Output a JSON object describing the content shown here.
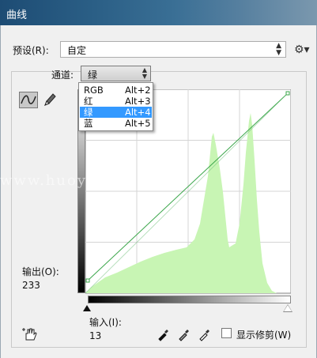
{
  "window": {
    "title": "曲线"
  },
  "preset": {
    "label": "预设(R):",
    "value": "自定"
  },
  "channel": {
    "label": "通道:",
    "value": "绿",
    "options": [
      {
        "name": "RGB",
        "shortcut": "Alt+2"
      },
      {
        "name": "红",
        "shortcut": "Alt+3"
      },
      {
        "name": "绿",
        "shortcut": "Alt+4",
        "selected": true
      },
      {
        "name": "蓝",
        "shortcut": "Alt+5"
      }
    ]
  },
  "output": {
    "label": "输出(O):",
    "value": "233"
  },
  "input": {
    "label": "输入(I):",
    "value": "13"
  },
  "show_clipping": {
    "label": "显示修剪(W)",
    "checked": false
  },
  "watermark": {
    "text": "www.huoy..."
  },
  "colors": {
    "histogram": "#c8f5b4",
    "curve": "#3aa64a",
    "menu_highlight": "#3399ff"
  },
  "icons": {
    "settings": "gear-icon",
    "curve_tool": "curve-tool-icon",
    "pencil_tool": "pencil-icon",
    "hand_tool": "hand-adjust-icon",
    "droppers": [
      "black-point-eyedropper-icon",
      "gray-point-eyedropper-icon",
      "white-point-eyedropper-icon"
    ]
  }
}
